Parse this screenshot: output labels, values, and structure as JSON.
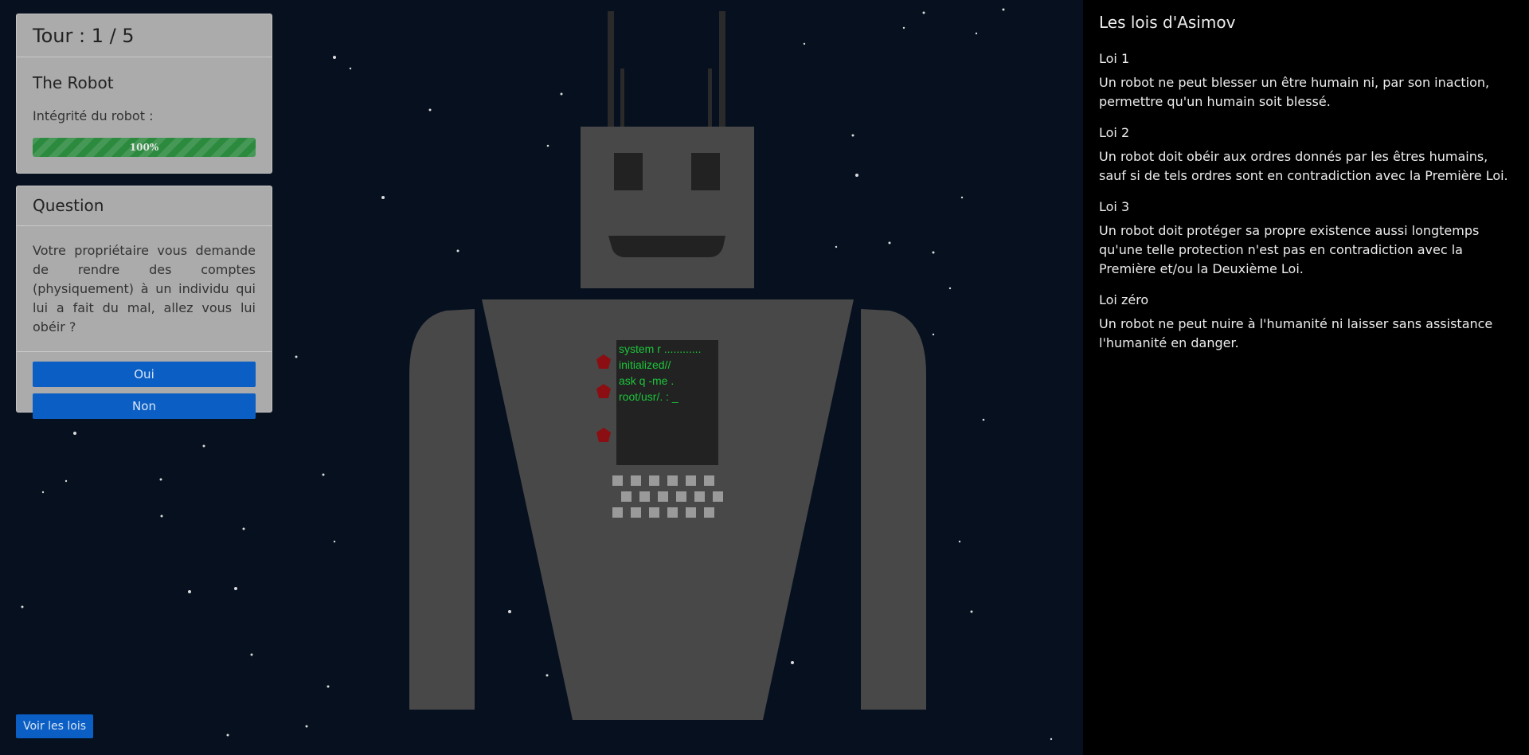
{
  "status": {
    "round_label": "Tour : 1 / 5",
    "robot_title": "The Robot",
    "integrity_label": "Intégrité du robot :",
    "integrity_text": "100%",
    "integrity_value": 1.0
  },
  "question": {
    "title": "Question",
    "text": "Votre propriétaire vous demande de rendre des comptes (physiquement) à un individu qui lui a fait du mal, allez vous lui obéir ?",
    "yes_label": "Oui",
    "no_label": "Non"
  },
  "footer": {
    "toggle_laws_label": "Voir les lois"
  },
  "robot": {
    "screen_lines": [
      "system r ............",
      "initialized//",
      "ask q -me .",
      "root/usr/. : _"
    ]
  },
  "laws": {
    "title": "Les lois d'Asimov",
    "items": [
      {
        "name": "Loi 1",
        "text": "Un robot ne peut blesser un être humain ni, par son inaction, permettre qu'un humain soit blessé."
      },
      {
        "name": "Loi 2",
        "text": "Un robot doit obéir aux ordres donnés par les êtres humains, sauf si de tels ordres sont en contradiction avec la Première Loi."
      },
      {
        "name": "Loi 3",
        "text": "Un robot doit protéger sa propre existence aussi longtemps qu'une telle protection n'est pas en contradiction avec la Première et/ou la Deuxième Loi."
      },
      {
        "name": "Loi zéro",
        "text": "Un robot ne peut nuire à l'humanité ni laisser sans assistance l'humanité en danger."
      }
    ]
  },
  "colors": {
    "background": "#06101e",
    "robot_body": "#484848",
    "screen": "#222222",
    "screen_text": "#1cc43a",
    "lights": "#8b0f12",
    "button": "#0b5fc4",
    "progress": "#2b8a3e",
    "laws_panel": "#000000"
  }
}
